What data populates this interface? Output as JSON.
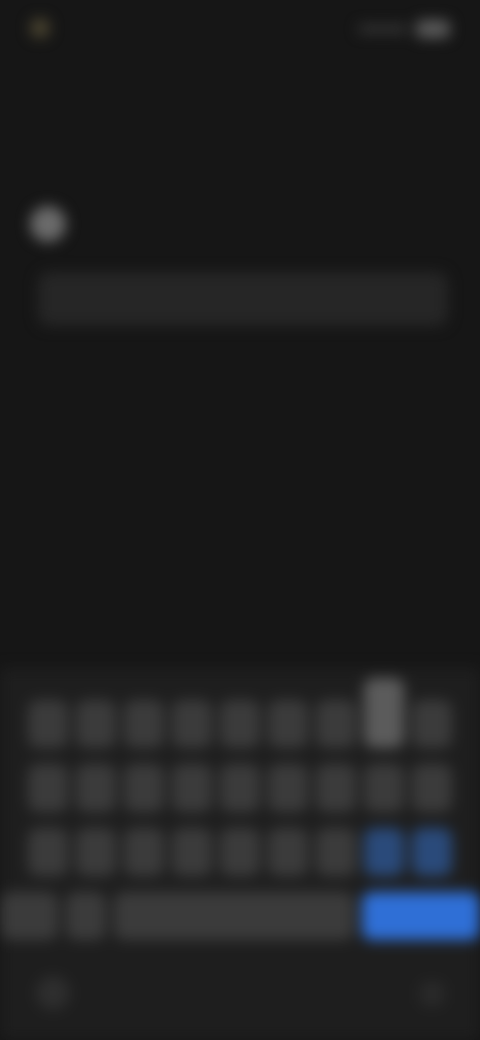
{
  "status_bar": {
    "time": "",
    "icons": [
      "signal-icon",
      "wifi-icon",
      "battery-icon"
    ]
  },
  "card": {
    "app_icon": "app-icon",
    "prompt": "",
    "input": {
      "value": "",
      "placeholder": ""
    }
  },
  "keyboard": {
    "row1": [
      "",
      "",
      "",
      "",
      "",
      "",
      "",
      "",
      ""
    ],
    "row2": [
      "",
      "",
      "",
      "",
      "",
      "",
      "",
      "",
      ""
    ],
    "row3": [
      "",
      "",
      "",
      "",
      "",
      "",
      "",
      "",
      ""
    ],
    "row4": {
      "mode": "",
      "emoji": "",
      "space": "",
      "enter": ""
    }
  },
  "nav_bar": {
    "left": "keyboard-hide-icon",
    "right": "keyboard-switch-icon"
  },
  "colors": {
    "background": "#161616",
    "keyboard": "#1e1e1e",
    "key": "#3b3b3b",
    "accent": "#2f6fd6"
  }
}
